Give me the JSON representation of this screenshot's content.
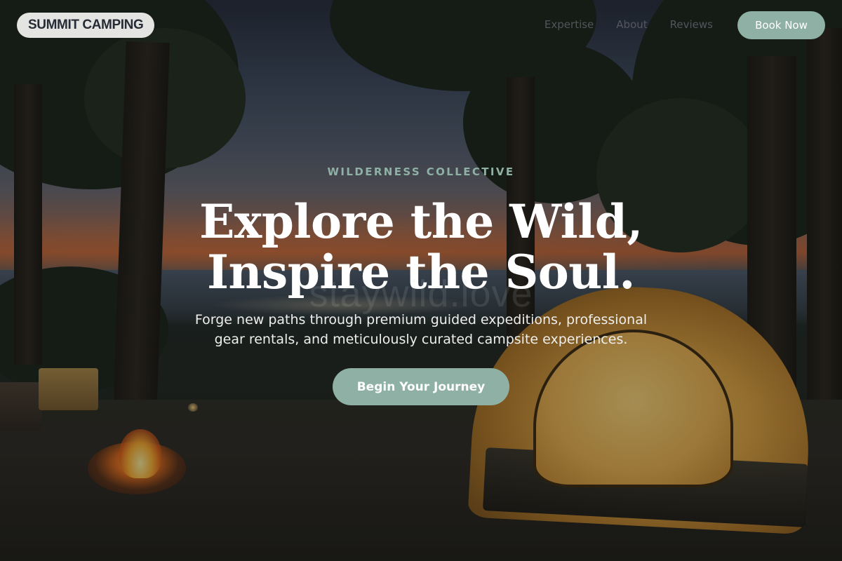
{
  "brand": {
    "logo_text": "SUMMIT CAMPING"
  },
  "nav": {
    "links": [
      {
        "label": "Expertise"
      },
      {
        "label": "About"
      },
      {
        "label": "Reviews"
      }
    ],
    "book_label": "Book Now"
  },
  "hero": {
    "eyebrow": "WILDERNESS COLLECTIVE",
    "headline_line1": "Explore the Wild,",
    "headline_line2": "Inspire the Soul.",
    "watermark": "staywild.love",
    "subtext": "Forge new paths through premium guided expeditions, professional gear rentals, and meticulously curated campsite experiences.",
    "cta_label": "Begin Your Journey"
  },
  "colors": {
    "accent": "#8fb0a4",
    "logo_bg": "#e4e4e2",
    "logo_text": "#262c36",
    "headline": "#ffffff"
  },
  "background": {
    "icon": "campsite-photo"
  }
}
